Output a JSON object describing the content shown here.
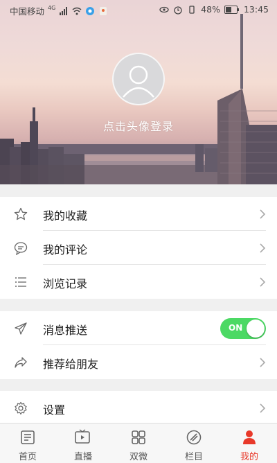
{
  "status_bar": {
    "carrier": "中国移动",
    "network": "4G",
    "battery": "48%",
    "time": "13:45"
  },
  "profile": {
    "login_prompt": "点击头像登录"
  },
  "menu_group_1": [
    {
      "label": "我的收藏",
      "icon": "star-icon"
    },
    {
      "label": "我的评论",
      "icon": "comment-icon"
    },
    {
      "label": "浏览记录",
      "icon": "list-icon"
    }
  ],
  "menu_group_2": [
    {
      "label": "消息推送",
      "icon": "send-icon",
      "toggle": "ON"
    },
    {
      "label": "推荐给朋友",
      "icon": "share-icon"
    }
  ],
  "menu_group_3": [
    {
      "label": "设置",
      "icon": "gear-icon"
    }
  ],
  "bottom_nav": [
    {
      "label": "首页",
      "icon": "news-icon"
    },
    {
      "label": "直播",
      "icon": "live-video-icon"
    },
    {
      "label": "双微",
      "icon": "grid-icon"
    },
    {
      "label": "栏目",
      "icon": "column-icon"
    },
    {
      "label": "我的",
      "icon": "person-icon",
      "active": true
    }
  ],
  "colors": {
    "accent": "#e8392a",
    "toggle_on": "#4cd964"
  }
}
